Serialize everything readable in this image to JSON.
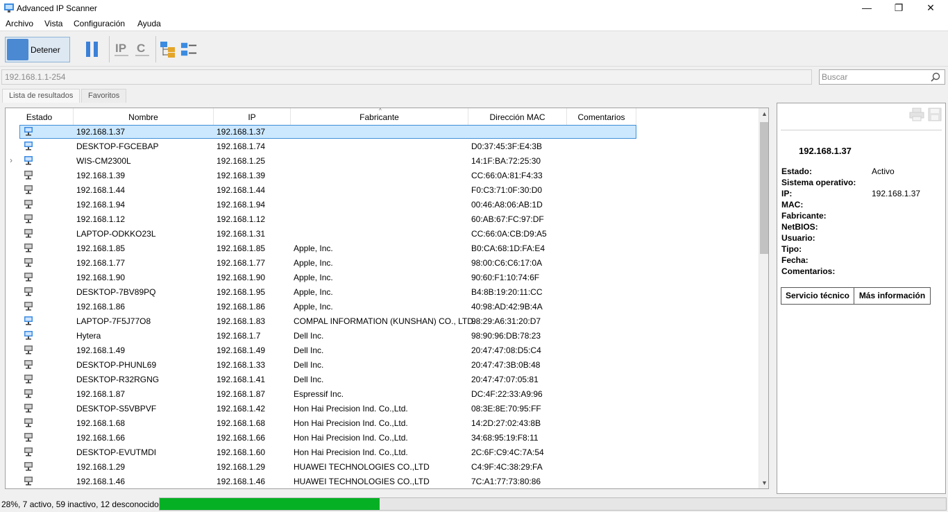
{
  "window": {
    "title": "Advanced IP Scanner",
    "minimize": "—",
    "maximize": "❐",
    "close": "✕"
  },
  "menu": [
    "Archivo",
    "Vista",
    "Configuración",
    "Ayuda"
  ],
  "toolbar": {
    "stop_label": "Detener"
  },
  "address": {
    "range": "192.168.1.1-254",
    "search_placeholder": "Buscar"
  },
  "tabs": [
    "Lista de resultados",
    "Favoritos"
  ],
  "columns": [
    "Estado",
    "Nombre",
    "IP",
    "Fabricante",
    "Dirección MAC",
    "Comentarios"
  ],
  "rows": [
    {
      "status": "active",
      "name": "192.168.1.37",
      "ip": "192.168.1.37",
      "vendor": "",
      "mac": "",
      "selected": true
    },
    {
      "status": "active",
      "name": "DESKTOP-FGCEBAP",
      "ip": "192.168.1.74",
      "vendor": "",
      "mac": "D0:37:45:3F:E4:3B"
    },
    {
      "status": "active",
      "name": "WIS-CM2300L",
      "ip": "192.168.1.25",
      "vendor": "",
      "mac": "14:1F:BA:72:25:30",
      "expandable": true
    },
    {
      "status": "inactive",
      "name": "192.168.1.39",
      "ip": "192.168.1.39",
      "vendor": "",
      "mac": "CC:66:0A:81:F4:33"
    },
    {
      "status": "inactive",
      "name": "192.168.1.44",
      "ip": "192.168.1.44",
      "vendor": "",
      "mac": "F0:C3:71:0F:30:D0"
    },
    {
      "status": "inactive",
      "name": "192.168.1.94",
      "ip": "192.168.1.94",
      "vendor": "",
      "mac": "00:46:A8:06:AB:1D"
    },
    {
      "status": "inactive",
      "name": "192.168.1.12",
      "ip": "192.168.1.12",
      "vendor": "",
      "mac": "60:AB:67:FC:97:DF"
    },
    {
      "status": "inactive",
      "name": "LAPTOP-ODKKO23L",
      "ip": "192.168.1.31",
      "vendor": "",
      "mac": "CC:66:0A:CB:D9:A5"
    },
    {
      "status": "inactive",
      "name": "192.168.1.85",
      "ip": "192.168.1.85",
      "vendor": "Apple, Inc.",
      "mac": "B0:CA:68:1D:FA:E4"
    },
    {
      "status": "inactive",
      "name": "192.168.1.77",
      "ip": "192.168.1.77",
      "vendor": "Apple, Inc.",
      "mac": "98:00:C6:C6:17:0A"
    },
    {
      "status": "inactive",
      "name": "192.168.1.90",
      "ip": "192.168.1.90",
      "vendor": "Apple, Inc.",
      "mac": "90:60:F1:10:74:6F"
    },
    {
      "status": "inactive",
      "name": "DESKTOP-7BV89PQ",
      "ip": "192.168.1.95",
      "vendor": "Apple, Inc.",
      "mac": "B4:8B:19:20:11:CC"
    },
    {
      "status": "inactive",
      "name": "192.168.1.86",
      "ip": "192.168.1.86",
      "vendor": "Apple, Inc.",
      "mac": "40:98:AD:42:9B:4A"
    },
    {
      "status": "active",
      "name": "LAPTOP-7F5J77O8",
      "ip": "192.168.1.83",
      "vendor": "COMPAL INFORMATION (KUNSHAN) CO., LTD.",
      "mac": "98:29:A6:31:20:D7"
    },
    {
      "status": "active",
      "name": "Hytera",
      "ip": "192.168.1.7",
      "vendor": "Dell Inc.",
      "mac": "98:90:96:DB:78:23"
    },
    {
      "status": "inactive",
      "name": "192.168.1.49",
      "ip": "192.168.1.49",
      "vendor": "Dell Inc.",
      "mac": "20:47:47:08:D5:C4"
    },
    {
      "status": "inactive",
      "name": "DESKTOP-PHUNL69",
      "ip": "192.168.1.33",
      "vendor": "Dell Inc.",
      "mac": "20:47:47:3B:0B:48"
    },
    {
      "status": "inactive",
      "name": "DESKTOP-R32RGNG",
      "ip": "192.168.1.41",
      "vendor": "Dell Inc.",
      "mac": "20:47:47:07:05:81"
    },
    {
      "status": "inactive",
      "name": "192.168.1.87",
      "ip": "192.168.1.87",
      "vendor": "Espressif Inc.",
      "mac": "DC:4F:22:33:A9:96"
    },
    {
      "status": "inactive",
      "name": "DESKTOP-S5VBPVF",
      "ip": "192.168.1.42",
      "vendor": "Hon Hai Precision Ind. Co.,Ltd.",
      "mac": "08:3E:8E:70:95:FF"
    },
    {
      "status": "inactive",
      "name": "192.168.1.68",
      "ip": "192.168.1.68",
      "vendor": "Hon Hai Precision Ind. Co.,Ltd.",
      "mac": "14:2D:27:02:43:8B"
    },
    {
      "status": "inactive",
      "name": "192.168.1.66",
      "ip": "192.168.1.66",
      "vendor": "Hon Hai Precision Ind. Co.,Ltd.",
      "mac": "34:68:95:19:F8:11"
    },
    {
      "status": "inactive",
      "name": "DESKTOP-EVUTMDI",
      "ip": "192.168.1.60",
      "vendor": "Hon Hai Precision Ind. Co.,Ltd.",
      "mac": "2C:6F:C9:4C:7A:54"
    },
    {
      "status": "inactive",
      "name": "192.168.1.29",
      "ip": "192.168.1.29",
      "vendor": "HUAWEI TECHNOLOGIES CO.,LTD",
      "mac": "C4:9F:4C:38:29:FA"
    },
    {
      "status": "inactive",
      "name": "192.168.1.46",
      "ip": "192.168.1.46",
      "vendor": "HUAWEI TECHNOLOGIES CO.,LTD",
      "mac": "7C:A1:77:73:80:86"
    }
  ],
  "details": {
    "ip_title": "192.168.1.37",
    "labels": [
      "Estado:",
      "Sistema operativo:",
      "IP:",
      "MAC:",
      "Fabricante:",
      "NetBIOS:",
      "Usuario:",
      "Tipo:",
      "Fecha:",
      "Comentarios:"
    ],
    "values": [
      "Activo",
      "",
      "192.168.1.37",
      "",
      "",
      "",
      "",
      "",
      "",
      ""
    ],
    "buttons": [
      "Servicio técnico",
      "Más información"
    ]
  },
  "status": {
    "text": "28%, 7 activo, 59 inactivo, 12 desconocido",
    "progress": 0.28
  },
  "colors": {
    "active_icon": "#3b8be0",
    "inactive_icon": "#6e6e6e",
    "progress": "#06b025",
    "selection": "#cce8ff"
  }
}
